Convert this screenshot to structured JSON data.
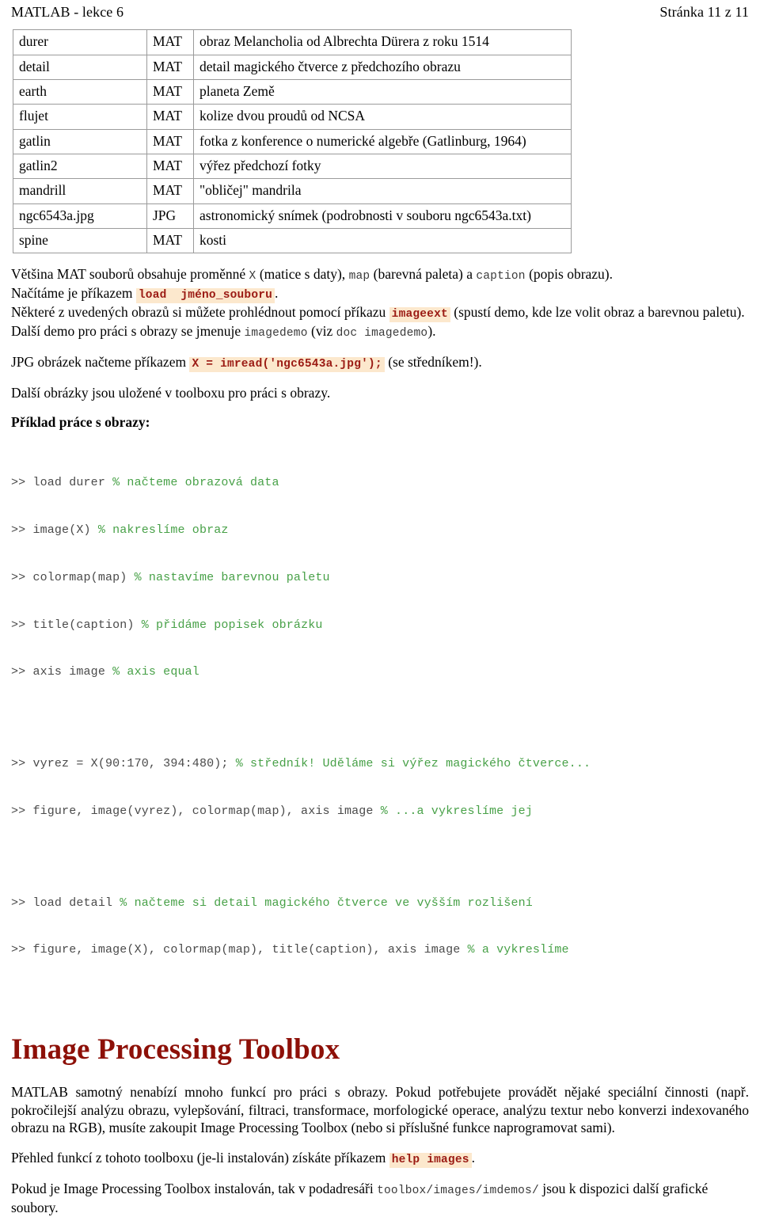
{
  "header": {
    "doc_title": "MATLAB - lekce 6",
    "page_indicator": "Stránka 11 z 11"
  },
  "file_table": {
    "rows": [
      {
        "name": "durer",
        "type": "MAT",
        "desc": "obraz Melancholia od Albrechta Dürera z roku 1514"
      },
      {
        "name": "detail",
        "type": "MAT",
        "desc": "detail magického čtverce z předchozího obrazu"
      },
      {
        "name": "earth",
        "type": "MAT",
        "desc": "planeta Země"
      },
      {
        "name": "flujet",
        "type": "MAT",
        "desc": "kolize dvou proudů od NCSA"
      },
      {
        "name": "gatlin",
        "type": "MAT",
        "desc": "fotka z konference o numerické algebře (Gatlinburg, 1964)"
      },
      {
        "name": "gatlin2",
        "type": "MAT",
        "desc": "výřez předchozí fotky"
      },
      {
        "name": "mandrill",
        "type": "MAT",
        "desc": "\"obličej\" mandrila"
      },
      {
        "name": "ngc6543a.jpg",
        "type": "JPG",
        "desc": "astronomický snímek (podrobnosti v souboru ngc6543a.txt)"
      },
      {
        "name": "spine",
        "type": "MAT",
        "desc": "kosti"
      }
    ]
  },
  "body": {
    "p1_a": "Většina MAT souborů obsahuje proměnné ",
    "p1_code1": "X",
    "p1_b": " (matice s daty), ",
    "p1_code2": "map",
    "p1_c": " (barevná paleta) a ",
    "p1_code3": "caption",
    "p1_d": " (popis obrazu).",
    "p2_a": "Načítáme je příkazem ",
    "p2_code": "load  jméno_souboru",
    "p2_b": ".",
    "p3_a": "Některé z uvedených obrazů si můžete prohlédnout pomocí příkazu ",
    "p3_code": "imageext",
    "p3_b": " (spustí demo, kde lze volit obraz a barevnou paletu).",
    "p4_a": "Další demo pro práci s obrazy se jmenuje ",
    "p4_code1": "imagedemo",
    "p4_b": " (viz ",
    "p4_code2": "doc imagedemo",
    "p4_c": ").",
    "p5_a": "JPG obrázek načteme příkazem ",
    "p5_code": "X = imread('ngc6543a.jpg');",
    "p5_b": " (se středníkem!).",
    "p6": "Další obrázky jsou uložené v toolboxu pro práci s obrazy.",
    "example_heading": "Příklad práce s obrazy:"
  },
  "console": {
    "group1": [
      {
        "cmd": ">> load durer ",
        "comment": "% načteme obrazová data"
      },
      {
        "cmd": ">> image(X) ",
        "comment": "% nakreslíme obraz"
      },
      {
        "cmd": ">> colormap(map) ",
        "comment": "% nastavíme barevnou paletu"
      },
      {
        "cmd": ">> title(caption) ",
        "comment": "% přidáme popisek obrázku"
      },
      {
        "cmd": ">> axis image ",
        "comment": "% axis equal"
      }
    ],
    "group2": [
      {
        "cmd": ">> vyrez = X(90:170, 394:480); ",
        "comment": "% středník! Uděláme si výřez magického čtverce..."
      },
      {
        "cmd": ">> figure, image(vyrez), colormap(map), axis image ",
        "comment": "% ...a vykreslíme jej"
      }
    ],
    "group3": [
      {
        "cmd": ">> load detail ",
        "comment": "% načteme si detail magického čtverce ve vyšším rozlišení"
      },
      {
        "cmd": ">> figure, image(X), colormap(map), title(caption), axis image ",
        "comment": "% a vykreslíme"
      }
    ]
  },
  "toolbox": {
    "title": "Image Processing Toolbox",
    "p1": "MATLAB samotný nenabízí mnoho funkcí pro práci s obrazy. Pokud potřebujete provádět nějaké speciální činnosti (např. pokročilejší analýzu obrazu, vylepšování, filtraci, transformace, morfologické operace, analýzu textur nebo konverzi indexovaného obrazu na RGB), musíte zakoupit Image Processing Toolbox (nebo si příslušné funkce naprogramovat sami).",
    "p2_a": "Přehled funkcí z tohoto toolboxu (je-li instalován) získáte příkazem ",
    "p2_code": "help images",
    "p2_b": ".",
    "p3_a": "Pokud je Image Processing Toolbox instalován, tak v podadresáři ",
    "p3_code": "toolbox/images/imdemos/",
    "p3_b": " jsou k dispozici další grafické soubory."
  },
  "colors": {
    "heading": "#8d1008",
    "code_highlight_bg": "#fce8cd",
    "code_highlight_fg": "#9b1b14",
    "comment_green": "#48a148",
    "table_border": "#9b9b9b"
  }
}
